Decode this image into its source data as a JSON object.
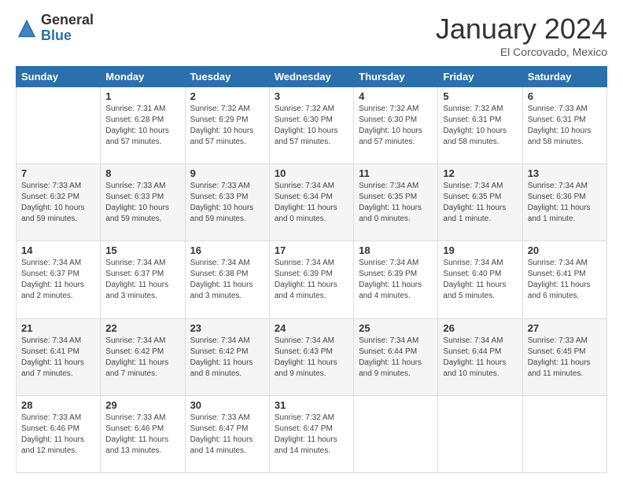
{
  "logo": {
    "general": "General",
    "blue": "Blue"
  },
  "title": "January 2024",
  "location": "El Corcovado, Mexico",
  "days_header": [
    "Sunday",
    "Monday",
    "Tuesday",
    "Wednesday",
    "Thursday",
    "Friday",
    "Saturday"
  ],
  "weeks": [
    [
      {
        "day": "",
        "info": ""
      },
      {
        "day": "1",
        "info": "Sunrise: 7:31 AM\nSunset: 6:28 PM\nDaylight: 10 hours\nand 57 minutes."
      },
      {
        "day": "2",
        "info": "Sunrise: 7:32 AM\nSunset: 6:29 PM\nDaylight: 10 hours\nand 57 minutes."
      },
      {
        "day": "3",
        "info": "Sunrise: 7:32 AM\nSunset: 6:30 PM\nDaylight: 10 hours\nand 57 minutes."
      },
      {
        "day": "4",
        "info": "Sunrise: 7:32 AM\nSunset: 6:30 PM\nDaylight: 10 hours\nand 57 minutes."
      },
      {
        "day": "5",
        "info": "Sunrise: 7:32 AM\nSunset: 6:31 PM\nDaylight: 10 hours\nand 58 minutes."
      },
      {
        "day": "6",
        "info": "Sunrise: 7:33 AM\nSunset: 6:31 PM\nDaylight: 10 hours\nand 58 minutes."
      }
    ],
    [
      {
        "day": "7",
        "info": "Sunrise: 7:33 AM\nSunset: 6:32 PM\nDaylight: 10 hours\nand 59 minutes."
      },
      {
        "day": "8",
        "info": "Sunrise: 7:33 AM\nSunset: 6:33 PM\nDaylight: 10 hours\nand 59 minutes."
      },
      {
        "day": "9",
        "info": "Sunrise: 7:33 AM\nSunset: 6:33 PM\nDaylight: 10 hours\nand 59 minutes."
      },
      {
        "day": "10",
        "info": "Sunrise: 7:34 AM\nSunset: 6:34 PM\nDaylight: 11 hours\nand 0 minutes."
      },
      {
        "day": "11",
        "info": "Sunrise: 7:34 AM\nSunset: 6:35 PM\nDaylight: 11 hours\nand 0 minutes."
      },
      {
        "day": "12",
        "info": "Sunrise: 7:34 AM\nSunset: 6:35 PM\nDaylight: 11 hours\nand 1 minute."
      },
      {
        "day": "13",
        "info": "Sunrise: 7:34 AM\nSunset: 6:36 PM\nDaylight: 11 hours\nand 1 minute."
      }
    ],
    [
      {
        "day": "14",
        "info": "Sunrise: 7:34 AM\nSunset: 6:37 PM\nDaylight: 11 hours\nand 2 minutes."
      },
      {
        "day": "15",
        "info": "Sunrise: 7:34 AM\nSunset: 6:37 PM\nDaylight: 11 hours\nand 3 minutes."
      },
      {
        "day": "16",
        "info": "Sunrise: 7:34 AM\nSunset: 6:38 PM\nDaylight: 11 hours\nand 3 minutes."
      },
      {
        "day": "17",
        "info": "Sunrise: 7:34 AM\nSunset: 6:39 PM\nDaylight: 11 hours\nand 4 minutes."
      },
      {
        "day": "18",
        "info": "Sunrise: 7:34 AM\nSunset: 6:39 PM\nDaylight: 11 hours\nand 4 minutes."
      },
      {
        "day": "19",
        "info": "Sunrise: 7:34 AM\nSunset: 6:40 PM\nDaylight: 11 hours\nand 5 minutes."
      },
      {
        "day": "20",
        "info": "Sunrise: 7:34 AM\nSunset: 6:41 PM\nDaylight: 11 hours\nand 6 minutes."
      }
    ],
    [
      {
        "day": "21",
        "info": "Sunrise: 7:34 AM\nSunset: 6:41 PM\nDaylight: 11 hours\nand 7 minutes."
      },
      {
        "day": "22",
        "info": "Sunrise: 7:34 AM\nSunset: 6:42 PM\nDaylight: 11 hours\nand 7 minutes."
      },
      {
        "day": "23",
        "info": "Sunrise: 7:34 AM\nSunset: 6:42 PM\nDaylight: 11 hours\nand 8 minutes."
      },
      {
        "day": "24",
        "info": "Sunrise: 7:34 AM\nSunset: 6:43 PM\nDaylight: 11 hours\nand 9 minutes."
      },
      {
        "day": "25",
        "info": "Sunrise: 7:34 AM\nSunset: 6:44 PM\nDaylight: 11 hours\nand 9 minutes."
      },
      {
        "day": "26",
        "info": "Sunrise: 7:34 AM\nSunset: 6:44 PM\nDaylight: 11 hours\nand 10 minutes."
      },
      {
        "day": "27",
        "info": "Sunrise: 7:33 AM\nSunset: 6:45 PM\nDaylight: 11 hours\nand 11 minutes."
      }
    ],
    [
      {
        "day": "28",
        "info": "Sunrise: 7:33 AM\nSunset: 6:46 PM\nDaylight: 11 hours\nand 12 minutes."
      },
      {
        "day": "29",
        "info": "Sunrise: 7:33 AM\nSunset: 6:46 PM\nDaylight: 11 hours\nand 13 minutes."
      },
      {
        "day": "30",
        "info": "Sunrise: 7:33 AM\nSunset: 6:47 PM\nDaylight: 11 hours\nand 14 minutes."
      },
      {
        "day": "31",
        "info": "Sunrise: 7:32 AM\nSunset: 6:47 PM\nDaylight: 11 hours\nand 14 minutes."
      },
      {
        "day": "",
        "info": ""
      },
      {
        "day": "",
        "info": ""
      },
      {
        "day": "",
        "info": ""
      }
    ]
  ]
}
